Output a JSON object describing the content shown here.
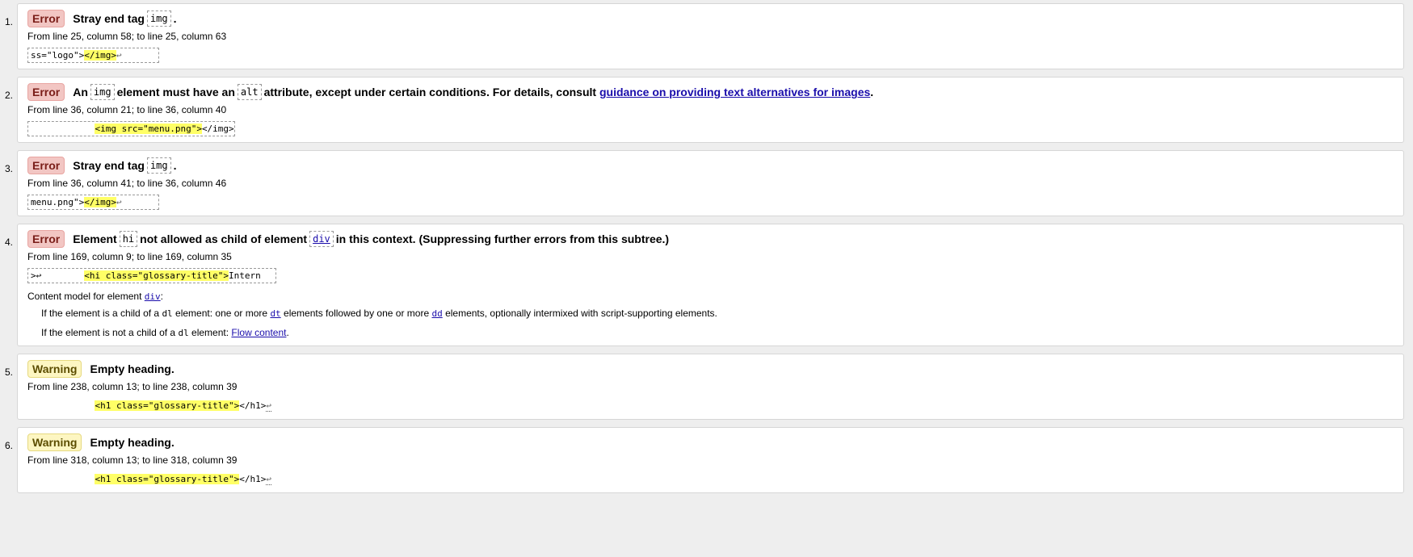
{
  "messages": [
    {
      "num": "1.",
      "type": "Error",
      "head_pre": "Stray end tag",
      "head_code": "img",
      "head_post": ".",
      "location": "From line 25, column 58; to line 25, column 63",
      "extract_pre": "ss=\"logo\">",
      "extract_hl": "</img>",
      "extract_post": "↩"
    },
    {
      "num": "2.",
      "type": "Error",
      "head_pre": "An",
      "head_code": "img",
      "head_mid": "element must have an",
      "head_code2": "alt",
      "head_mid2": "attribute, except under certain conditions. For details, consult",
      "head_link": "guidance on providing text alternatives for images",
      "head_post": ".",
      "location": "From line 36, column 21; to line 36, column 40",
      "extract_pre": "            ",
      "extract_hl": "<img src=\"menu.png\">",
      "extract_post": "</img>"
    },
    {
      "num": "3.",
      "type": "Error",
      "head_pre": "Stray end tag",
      "head_code": "img",
      "head_post": ".",
      "location": "From line 36, column 41; to line 36, column 46",
      "extract_pre": "menu.png\">",
      "extract_hl": "</img>",
      "extract_post": "↩"
    },
    {
      "num": "4.",
      "type": "Error",
      "head_pre": "Element",
      "head_code": "hi",
      "head_mid": "not allowed as child of element",
      "head_code_link": "div",
      "head_post": "in this context. (Suppressing further errors from this subtree.)",
      "location": "From line 169, column 9; to line 169, column 35",
      "extract_pre": ">↩        ",
      "extract_hl": "<hi class=\"glossary-title\">",
      "extract_post": "Intern",
      "content_model": {
        "label": "Content model for element",
        "element": "div",
        "colon": ":",
        "line1_pre": "If the element is a child of a",
        "line1_code": "dl",
        "line1_mid": "element: one or more",
        "line1_link1": "dt",
        "line1_mid2": "elements followed by one or more",
        "line1_link2": "dd",
        "line1_post": "elements, optionally intermixed with script-supporting elements.",
        "line2_pre": "If the element is not a child of a",
        "line2_code": "dl",
        "line2_mid": "element:",
        "line2_link": "Flow content",
        "line2_post": "."
      }
    },
    {
      "num": "5.",
      "type": "Warning",
      "head_pre": "Empty heading.",
      "location": "From line 238, column 13; to line 238, column 39",
      "extract_pre": "            ",
      "extract_hl": "<h1 class=\"glossary-title\">",
      "extract_post": "</h1>",
      "extract_end": "↩"
    },
    {
      "num": "6.",
      "type": "Warning",
      "head_pre": "Empty heading.",
      "location": "From line 318, column 13; to line 318, column 39",
      "extract_pre": "            ",
      "extract_hl": "<h1 class=\"glossary-title\">",
      "extract_post": "</h1>",
      "extract_end": "↩"
    }
  ],
  "colors": {
    "error_badge_bg": "#f2c6c3",
    "warning_badge_bg": "#fdf6c2",
    "highlight": "#ffff66",
    "link": "#1a0dab"
  }
}
